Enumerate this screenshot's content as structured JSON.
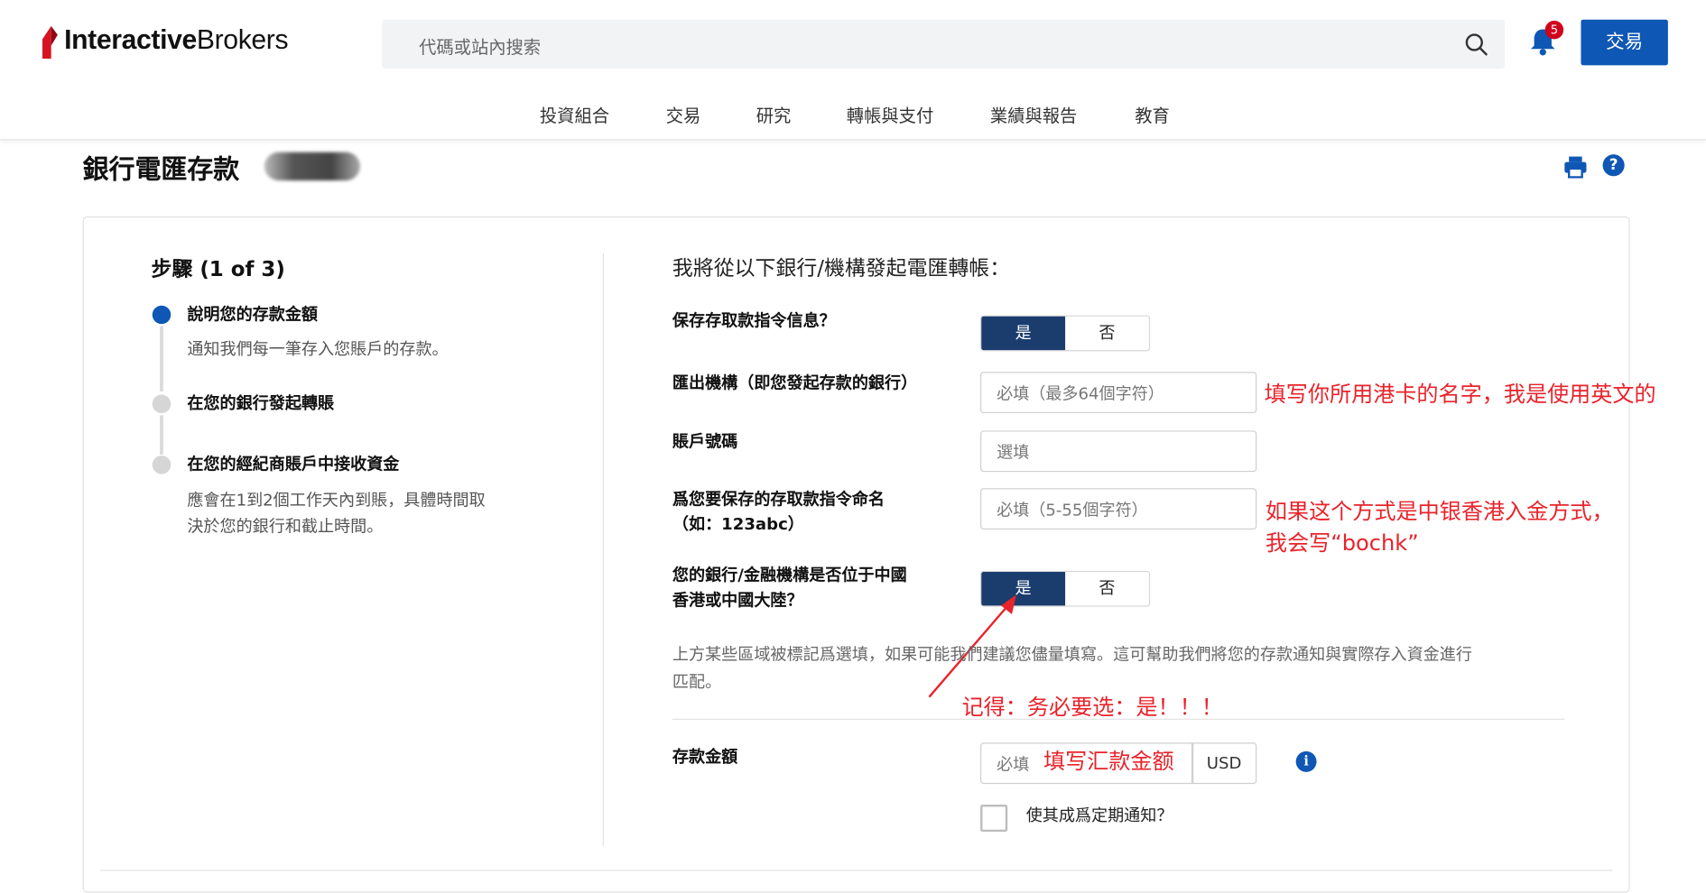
{
  "header": {
    "logo_bold": "Interactive",
    "logo_regular": "Brokers",
    "search_placeholder": "代碼或站內搜索",
    "notification_count": "5",
    "trade_button": "交易",
    "nav": [
      "投資組合",
      "交易",
      "研究",
      "轉帳與支付",
      "業績與報告",
      "教育"
    ]
  },
  "page": {
    "title": "銀行電匯存款",
    "help_glyph": "?"
  },
  "steps": {
    "title": "步驟 (1 of 3)",
    "items": [
      {
        "label": "說明您的存款金額",
        "desc": [
          "通知我們每一筆存入您賬戶的存款。"
        ],
        "state": "active"
      },
      {
        "label": "在您的銀行發起轉賬",
        "desc": [],
        "state": "pending"
      },
      {
        "label": "在您的經紀商賬戶中接收資金",
        "desc": [
          "應會在1到2個工作天內到賬，具體時間取",
          "決於您的銀行和截止時間。"
        ],
        "state": "pending"
      }
    ],
    "colors": {
      "active": "#0f57b4",
      "pending": "#d6d6d6"
    }
  },
  "form": {
    "section_title": "我將從以下銀行/機構發起電匯轉帳：",
    "save_instructions": {
      "label": "保存存取款指令信息？",
      "yes": "是",
      "no": "否",
      "selected": "是"
    },
    "bank_name": {
      "label": "匯出機構（即您發起存款的銀行）",
      "placeholder": "必填（最多64個字符）"
    },
    "account_number": {
      "label": "賬戶號碼",
      "placeholder": "選填"
    },
    "instruction_name": {
      "label_line1": "爲您要保存的存取款指令命名",
      "label_line2": "（如：123abc）",
      "placeholder": "必填（5-55個字符）"
    },
    "bank_location": {
      "label_line1": "您的銀行/金融機構是否位于中國",
      "label_line2": "香港或中國大陸？",
      "yes": "是",
      "no": "否",
      "selected": "是"
    },
    "note_line1": "上方某些區域被標記爲選填，如果可能我們建議您儘量填寫。這可幫助我們將您的存款通知與實際存入資金進行",
    "note_line2": "匹配。",
    "amount": {
      "label": "存款金額",
      "placeholder": "必填",
      "currency": "USD",
      "info_glyph": "i"
    },
    "recurring": {
      "label": "使其成爲定期通知？",
      "checked": false
    }
  },
  "annotations": {
    "bank_hint": "填写你所用港卡的名字，我是使用英文的",
    "name_hint_line1": "如果这个方式是中银香港入金方式，",
    "name_hint_line2": "我会写“bochk”",
    "location_hint": "记得：务必要选：是！！！",
    "amount_hint": "填写汇款金额",
    "color": "#e8232b"
  }
}
